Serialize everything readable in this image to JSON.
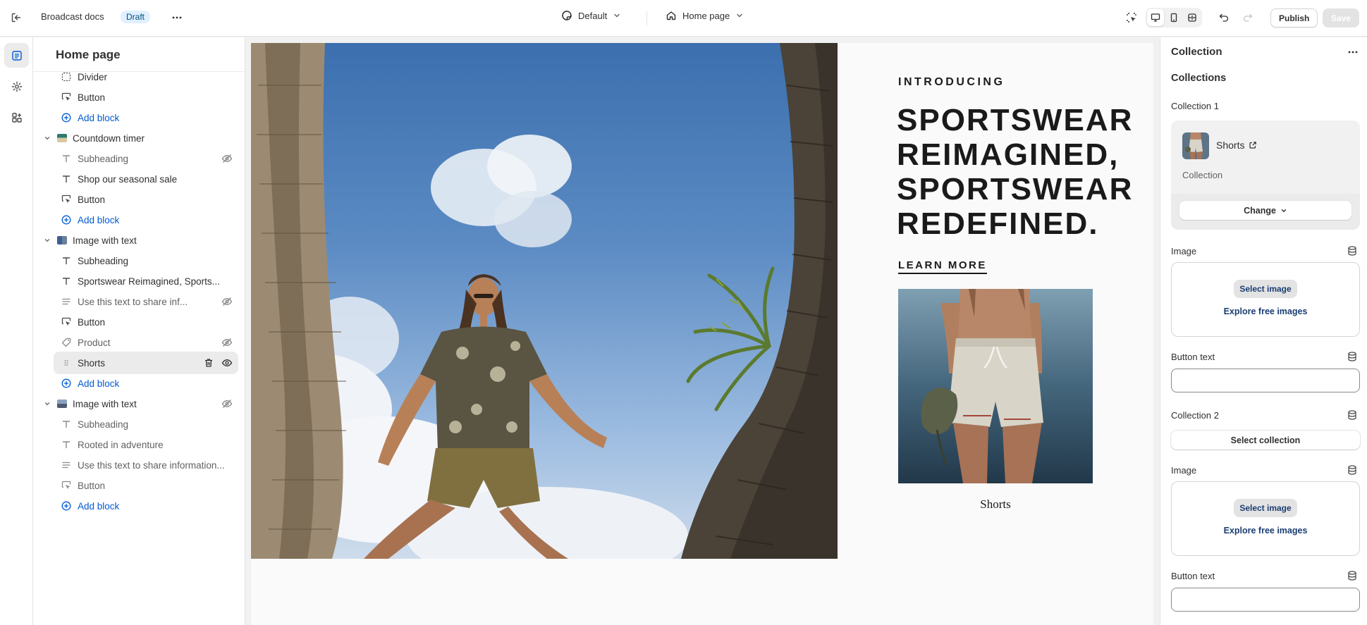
{
  "topbar": {
    "store_name": "Broadcast docs",
    "status_badge": "Draft",
    "theme_label": "Default",
    "page_label": "Home page",
    "publish_label": "Publish",
    "save_label": "Save",
    "active_device": "desktop"
  },
  "left_panel": {
    "title": "Home page",
    "rows": [
      {
        "label": "Divider",
        "icon": "divider-icon",
        "kind": "block"
      },
      {
        "label": "Button",
        "icon": "button-icon",
        "kind": "block"
      },
      {
        "label": "Add block",
        "icon": "plus-circle-icon",
        "kind": "add"
      },
      {
        "label": "Countdown timer",
        "icon": "section-thumbnail",
        "kind": "section"
      },
      {
        "label": "Subheading",
        "icon": "text-icon",
        "kind": "block",
        "hidden": true
      },
      {
        "label": "Shop our seasonal sale",
        "icon": "text-icon",
        "kind": "block"
      },
      {
        "label": "Button",
        "icon": "button-icon",
        "kind": "block"
      },
      {
        "label": "Add block",
        "icon": "plus-circle-icon",
        "kind": "add"
      },
      {
        "label": "Image with text",
        "icon": "section-thumbnail",
        "kind": "section"
      },
      {
        "label": "Subheading",
        "icon": "text-icon",
        "kind": "block"
      },
      {
        "label": "Sportswear Reimagined, Sports...",
        "icon": "text-icon",
        "kind": "block"
      },
      {
        "label": "Use this text to share inf...",
        "icon": "paragraph-icon",
        "kind": "block",
        "hidden": true
      },
      {
        "label": "Button",
        "icon": "button-icon",
        "kind": "block"
      },
      {
        "label": "Product",
        "icon": "tag-icon",
        "kind": "block",
        "hidden": true
      },
      {
        "label": "Shorts",
        "icon": "drag-handle-icon",
        "kind": "block",
        "selected": true
      },
      {
        "label": "Add block",
        "icon": "plus-circle-icon",
        "kind": "add"
      },
      {
        "label": "Image with text",
        "icon": "section-thumbnail",
        "kind": "section",
        "hidden": true
      },
      {
        "label": "Subheading",
        "icon": "text-icon",
        "kind": "block"
      },
      {
        "label": "Rooted in adventure",
        "icon": "text-icon",
        "kind": "block"
      },
      {
        "label": "Use this text to share information...",
        "icon": "paragraph-icon",
        "kind": "block"
      },
      {
        "label": "Button",
        "icon": "button-icon",
        "kind": "block"
      },
      {
        "label": "Add block",
        "icon": "plus-circle-icon",
        "kind": "add"
      }
    ]
  },
  "preview": {
    "intro": "INTRODUCING",
    "heading": "SPORTSWEAR REIMAGINED, SPORTSWEAR REDEFINED.",
    "link": "LEARN MORE",
    "product_name": "Shorts"
  },
  "right_panel": {
    "title": "Collection",
    "heading": "Collections",
    "collection1": {
      "label": "Collection 1",
      "name": "Shorts",
      "type": "Collection",
      "change_label": "Change"
    },
    "image1": {
      "label": "Image",
      "select_label": "Select image",
      "explore_label": "Explore free images"
    },
    "button_text1": {
      "label": "Button text",
      "value": ""
    },
    "collection2": {
      "label": "Collection 2",
      "select_label": "Select collection"
    },
    "image2": {
      "label": "Image",
      "select_label": "Select image",
      "explore_label": "Explore free images"
    },
    "button_text2": {
      "label": "Button text",
      "value": ""
    }
  }
}
